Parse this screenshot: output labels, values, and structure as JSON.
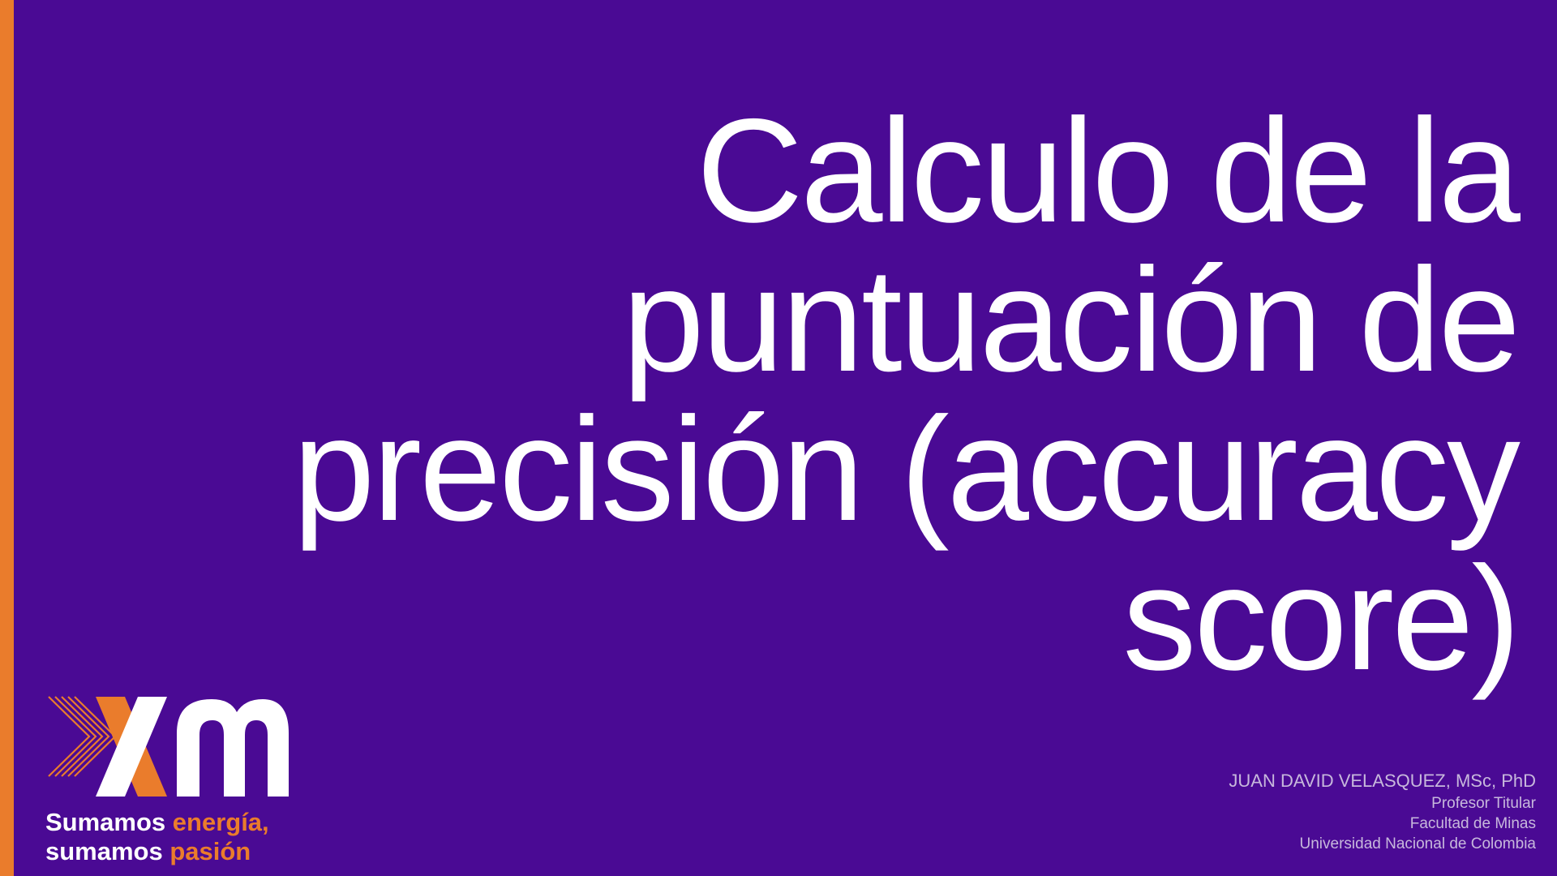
{
  "slide": {
    "title": "Calculo de la puntuación de precisión (accuracy score)",
    "background_color": "#4a0a94",
    "accent_color": "#ea7c2c"
  },
  "author": {
    "name": "JUAN DAVID VELASQUEZ, MSc, PhD",
    "position": "Profesor Titular",
    "faculty": "Facultad de Minas",
    "university": "Universidad Nacional de Colombia"
  },
  "logo": {
    "wordmark": "xm",
    "tagline_line1_white": "Sumamos ",
    "tagline_line1_orange": "energía,",
    "tagline_line2_white": "sumamos ",
    "tagline_line2_orange": "pasión"
  }
}
